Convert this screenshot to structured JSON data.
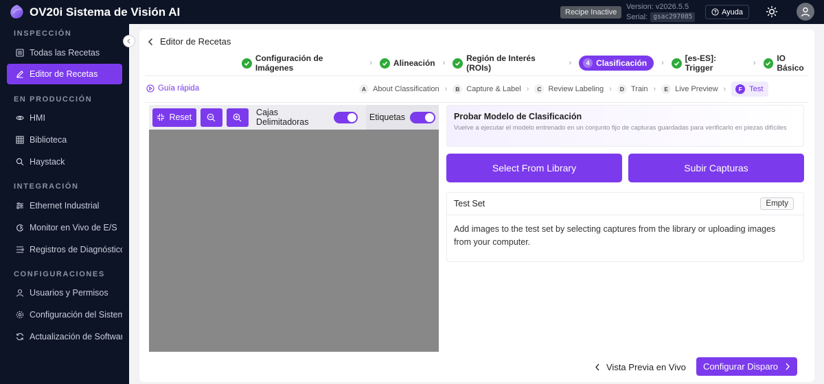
{
  "header": {
    "app_title": "OV20i Sistema de Visión AI",
    "recipe_status": "Recipe Inactive",
    "version": "Version: v2026.5.5",
    "serial_label": "Serial:",
    "serial_code": "gsac297085",
    "help": "Ayuda"
  },
  "sidebar": {
    "sections": [
      {
        "title": "INSPECCIÓN",
        "items": [
          {
            "label": "Todas las Recetas",
            "icon": "list-icon"
          },
          {
            "label": "Editor de Recetas",
            "icon": "edit-icon",
            "active": true
          }
        ]
      },
      {
        "title": "EN PRODUCCIÓN",
        "items": [
          {
            "label": "HMI",
            "icon": "eye-icon"
          },
          {
            "label": "Biblioteca",
            "icon": "grid-icon"
          },
          {
            "label": "Haystack",
            "icon": "search-icon"
          }
        ]
      },
      {
        "title": "INTEGRACIÓN",
        "items": [
          {
            "label": "Ethernet Industrial",
            "icon": "network-icon"
          },
          {
            "label": "Monitor en Vivo de E/S",
            "icon": "monitor-icon"
          },
          {
            "label": "Registros de Diagnóstico",
            "icon": "diagnostics-icon"
          }
        ]
      },
      {
        "title": "CONFIGURACIONES",
        "items": [
          {
            "label": "Usuarios y Permisos",
            "icon": "user-icon"
          },
          {
            "label": "Configuración del Sistema",
            "icon": "settings-icon"
          },
          {
            "label": "Actualización de Software",
            "icon": "refresh-icon"
          }
        ]
      }
    ]
  },
  "main": {
    "back_label": "Editor de Recetas",
    "steps": [
      {
        "label": "Configuración de Imágenes",
        "state": "done"
      },
      {
        "label": "Alineación",
        "state": "done"
      },
      {
        "label": "Región de Interés (ROIs)",
        "state": "done"
      },
      {
        "label": "Clasificación",
        "state": "current",
        "number": "4"
      },
      {
        "label": "[es-ES]: Trigger",
        "state": "done"
      },
      {
        "label": "IO Básico",
        "state": "done"
      }
    ],
    "guide_label": "Guía rápida",
    "substeps": [
      {
        "letter": "A",
        "label": "About Classification"
      },
      {
        "letter": "B",
        "label": "Capture & Label"
      },
      {
        "letter": "C",
        "label": "Review Labeling"
      },
      {
        "letter": "D",
        "label": "Train"
      },
      {
        "letter": "E",
        "label": "Live Preview"
      },
      {
        "letter": "F",
        "label": "Test",
        "current": true
      }
    ],
    "toolbar": {
      "reset": "Reset",
      "bbox_label": "Cajas Delimitadoras",
      "bbox_on": true,
      "labels_label": "Etiquetas",
      "labels_on": true
    },
    "test_panel": {
      "title": "Probar Modelo de Clasificación",
      "description": "Vuelve a ejecutar el modelo entrenado en un conjunto fijo de capturas guardadas para verificarlo en piezas difíciles",
      "select_btn": "Select From Library",
      "upload_btn": "Subir Capturas",
      "testset_title": "Test Set",
      "testset_badge": "Empty",
      "testset_body": "Add images to the test set by selecting captures from the library or uploading images from your computer."
    },
    "footer": {
      "preview": "Vista Previa en Vivo",
      "configure": "Configurar Disparo"
    }
  },
  "colors": {
    "accent": "#7c3aed",
    "sidebar_bg": "#0d1426",
    "success": "#2faa3a"
  }
}
